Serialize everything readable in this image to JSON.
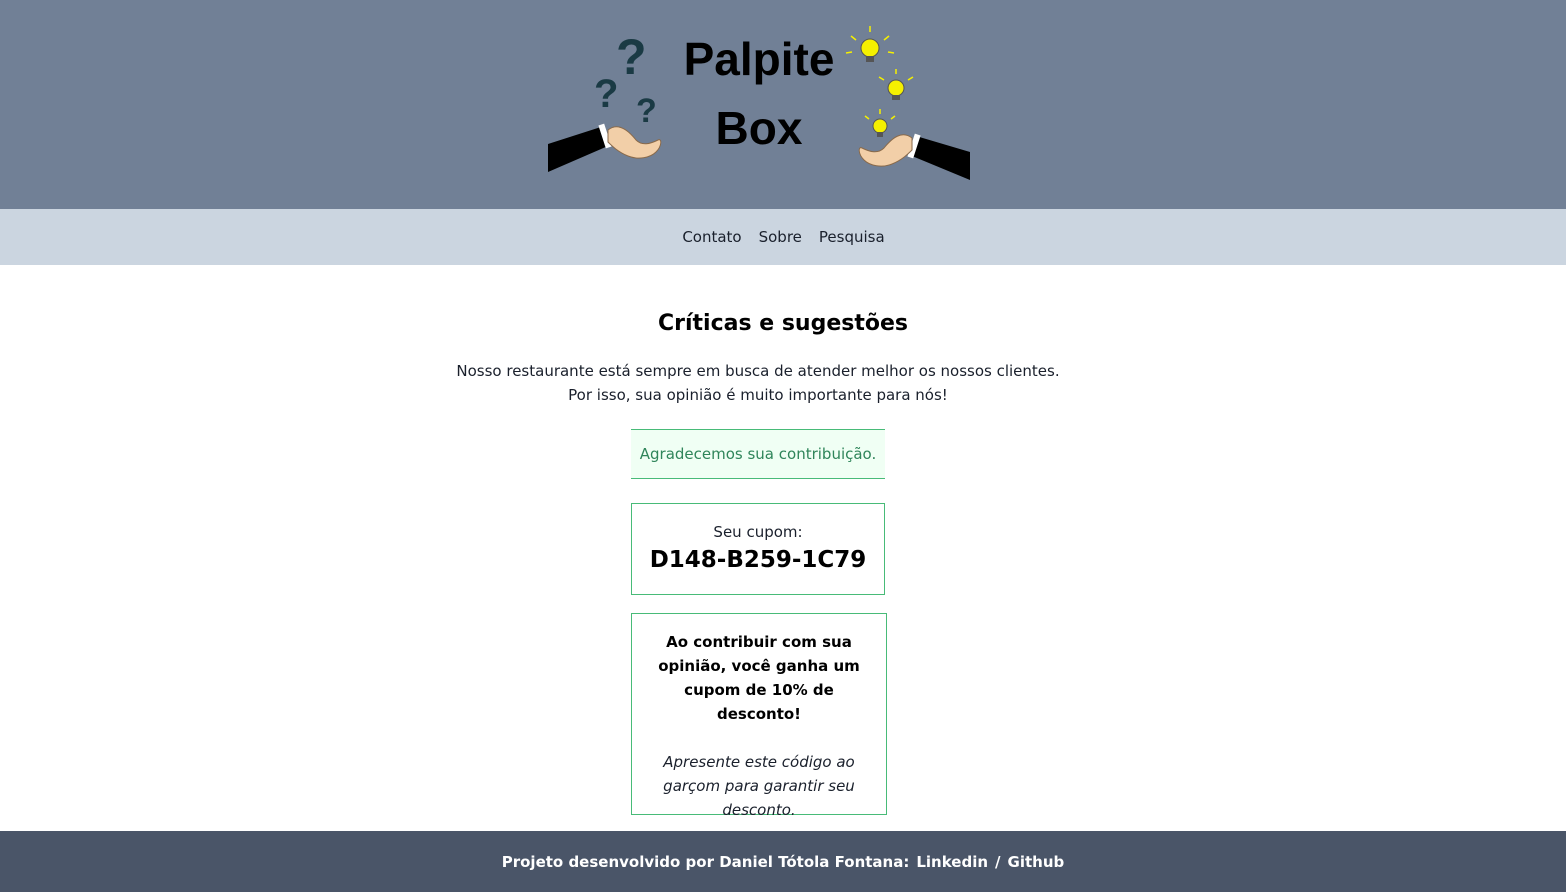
{
  "header": {
    "logo_line1": "Palpite",
    "logo_line2": "Box",
    "bg_color": "#718096"
  },
  "nav": {
    "items": [
      "Contato",
      "Sobre",
      "Pesquisa"
    ],
    "bg_color": "#CBD5E0"
  },
  "main": {
    "title": "Críticas e sugestões",
    "intro_line1": "Nosso restaurante está sempre em busca de atender melhor os nossos clientes.",
    "intro_line2": "Por isso, sua opinião é muito importante para nós!",
    "success_message": "Agradecemos sua contribuição.",
    "coupon_label": "Seu cupom:",
    "coupon_code": "D148-B259-1C79",
    "info_bold": "Ao contribuir com sua opinião, você ganha um cupom de 10% de desconto!",
    "info_italic": "Apresente este código ao garçom para garantir seu desconto.",
    "accent_color": "#48BB78"
  },
  "footer": {
    "text": "Projeto desenvolvido por Daniel Tótola Fontana:",
    "link1": "Linkedin",
    "separator": "/",
    "link2": "Github",
    "bg_color": "#4A5568"
  }
}
